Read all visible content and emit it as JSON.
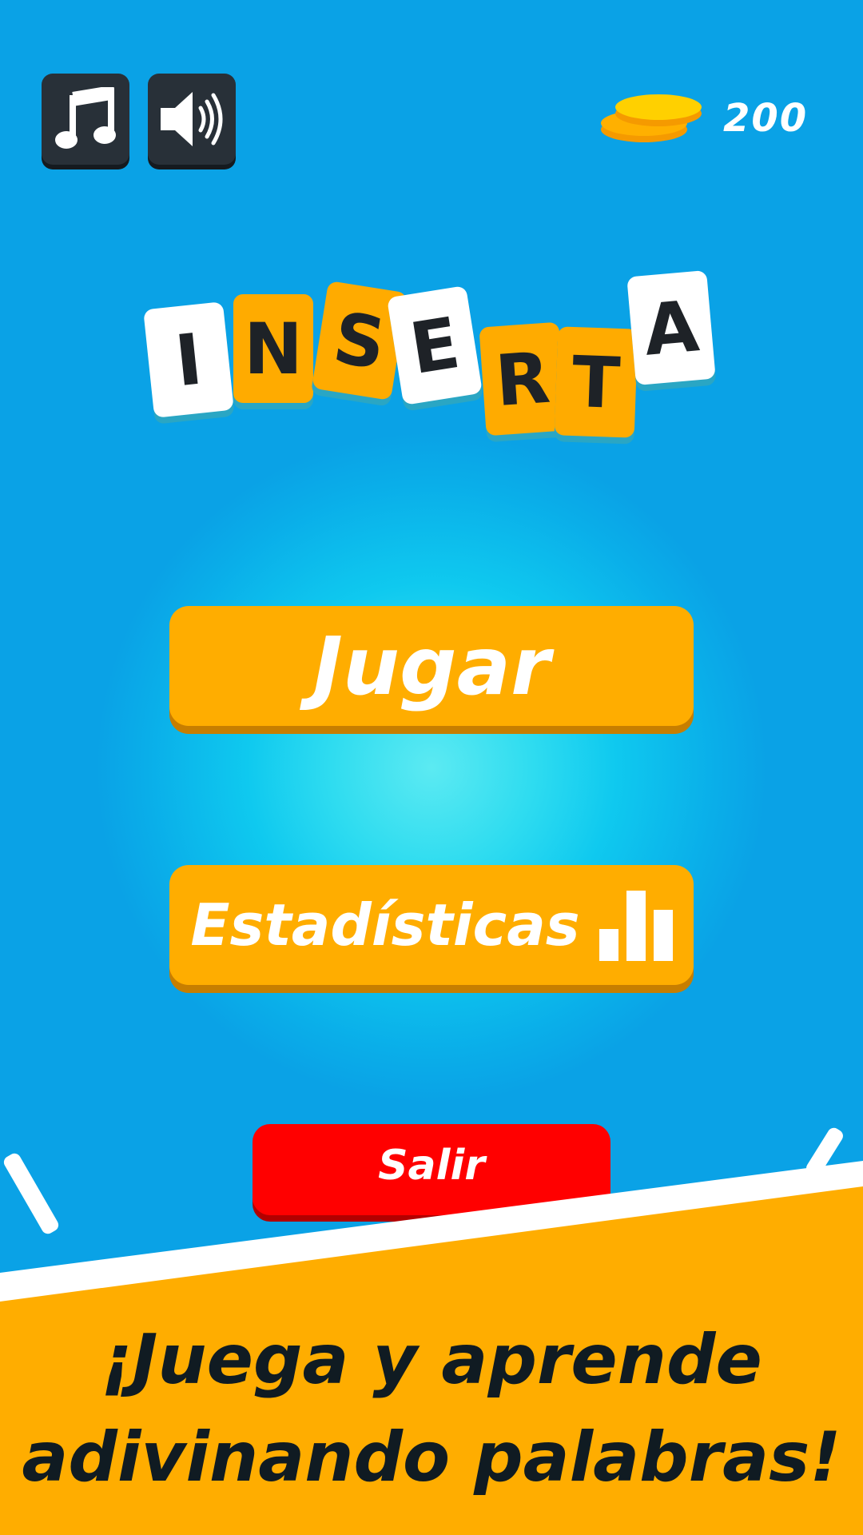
{
  "toolbar": {
    "music_icon": "music-note-icon",
    "sound_icon": "speaker-icon"
  },
  "wallet": {
    "coin_icon": "coins-icon",
    "coins": "200"
  },
  "logo": {
    "letters": [
      "I",
      "N",
      "S",
      "E",
      "R",
      "T",
      "A"
    ]
  },
  "menu": {
    "play_label": "Jugar",
    "stats_label": "Estadísticas",
    "stats_icon": "bar-chart-icon",
    "exit_label": "Salir"
  },
  "promo": {
    "line1": "¡Juega y aprende",
    "line2": "adivinando palabras!"
  },
  "colors": {
    "accent": "#ffad00",
    "exit": "#ff0000",
    "dark_button": "#283038",
    "text_dark": "#101b22"
  }
}
